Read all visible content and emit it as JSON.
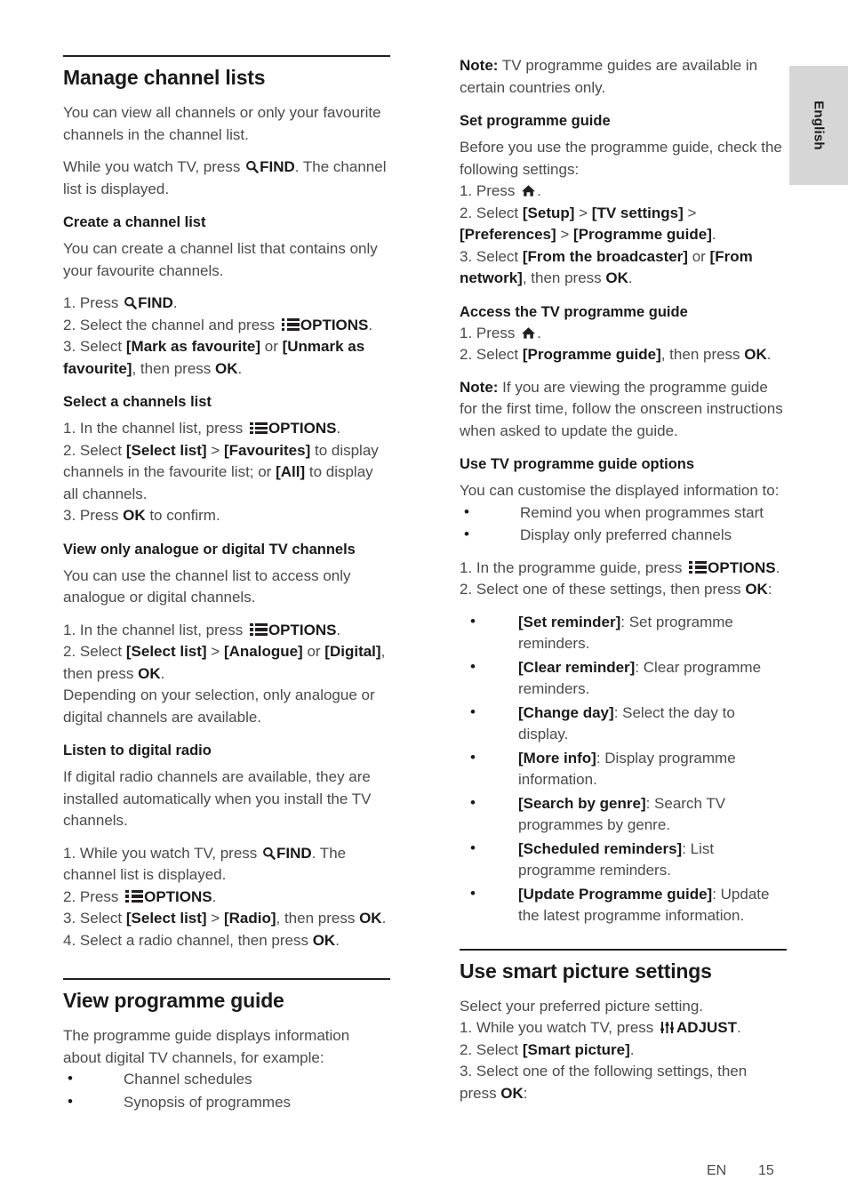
{
  "page": {
    "language_tab": "English",
    "footer_language_code": "EN",
    "footer_page_number": "15"
  },
  "icons": {
    "options": "options-list-icon",
    "home": "home-icon",
    "adjust": "adjust-sliders-icon",
    "find": "search-magnifier-icon"
  },
  "left_column": {
    "section_title": "Manage channel lists",
    "intro": "You can view all channels or only your favourite channels in the channel list.",
    "intro2_a": "While you watch TV, press ",
    "intro2_find": "FIND",
    "intro2_b": ". The channel list is displayed.",
    "create": {
      "heading": "Create a channel list",
      "body": "You can create a channel list that contains only your favourite channels.",
      "step1_a": "1. Press ",
      "step1_find": "FIND",
      "step1_b": ".",
      "step2_a": "2. Select the channel and press ",
      "step2_options": "OPTIONS",
      "step2_b": ".",
      "step3_a": "3. Select ",
      "step3_opt1": "[Mark as favourite]",
      "step3_mid": " or ",
      "step3_opt2": "[Unmark as favourite]",
      "step3_b": ", then press ",
      "step3_ok": "OK",
      "step3_c": "."
    },
    "select_list": {
      "heading": "Select a channels list",
      "step1_a": "1. In the channel list, press ",
      "step1_options": "OPTIONS",
      "step1_b": ".",
      "step2_a": "2. Select ",
      "step2_opt1": "[Select list]",
      "step2_gt": " > ",
      "step2_opt2": "[Favourites]",
      "step2_b": " to display channels in the favourite list; or ",
      "step2_opt3": "[All]",
      "step2_c": " to display all channels.",
      "step3_a": "3. Press ",
      "step3_ok": "OK",
      "step3_b": " to confirm."
    },
    "analogue_digital": {
      "heading": "View only analogue or digital TV channels",
      "body": "You can use the channel list to access only analogue or digital channels.",
      "step1_a": "1. In the channel list, press ",
      "step1_options": "OPTIONS",
      "step1_b": ".",
      "step2_a": "2. Select ",
      "step2_opt1": "[Select list]",
      "step2_gt": " > ",
      "step2_opt2": "[Analogue]",
      "step2_mid": " or ",
      "step2_opt3": "[Digital]",
      "step2_b": ", then press ",
      "step2_ok": "OK",
      "step2_c": ".",
      "note": "Depending on your selection, only analogue or digital channels are available."
    },
    "digital_radio": {
      "heading": "Listen to digital radio",
      "body": "If digital radio channels are available, they are installed automatically when you install the TV channels.",
      "step1_a": "1. While you watch TV, press ",
      "step1_find": "FIND",
      "step1_b": ". The channel list is displayed.",
      "step2_a": "2. Press ",
      "step2_options": "OPTIONS",
      "step2_b": ".",
      "step3_a": "3. Select ",
      "step3_opt1": "[Select list]",
      "step3_gt": " > ",
      "step3_opt2": "[Radio]",
      "step3_b": ", then press ",
      "step3_ok": "OK",
      "step3_c": ".",
      "step4_a": "4. Select a radio channel, then press ",
      "step4_ok": "OK",
      "step4_b": "."
    },
    "programme_guide": {
      "section_title": "View programme guide",
      "body": "The programme guide displays information about digital TV channels, for example:",
      "bullets": [
        "Channel schedules",
        "Synopsis of programmes"
      ]
    }
  },
  "right_column": {
    "note1_label": "Note:",
    "note1_text": " TV programme guides are available in certain countries only.",
    "set_guide": {
      "heading": "Set programme guide",
      "body": "Before you use the programme guide, check the following settings:",
      "step1_a": "1. Press ",
      "step1_b": ".",
      "step2_a": "2. Select ",
      "step2_opt1": "[Setup]",
      "step2_gt1": " > ",
      "step2_opt2": "[TV settings]",
      "step2_gt2": " > ",
      "step2_opt3": "[Preferences]",
      "step2_gt3": " > ",
      "step2_opt4": "[Programme guide]",
      "step2_b": ".",
      "step3_a": "3. Select ",
      "step3_opt1": "[From the broadcaster]",
      "step3_mid": " or ",
      "step3_opt2": "[From network]",
      "step3_b": ", then press ",
      "step3_ok": "OK",
      "step3_c": "."
    },
    "access_guide": {
      "heading": "Access the TV programme guide",
      "step1_a": "1. Press ",
      "step1_b": ".",
      "step2_a": "2. Select ",
      "step2_opt1": "[Programme guide]",
      "step2_b": ", then press ",
      "step2_ok": "OK",
      "step2_c": ".",
      "note_label": "Note:",
      "note_text": " If you are viewing the programme guide for the first time, follow the onscreen instructions when asked to update the guide."
    },
    "guide_options": {
      "heading": "Use TV programme guide options",
      "body": "You can customise the displayed information to:",
      "bullets": [
        "Remind you when programmes start",
        "Display only preferred channels"
      ],
      "step1_a": "1. In the programme guide, press ",
      "step1_options": "OPTIONS",
      "step1_b": ".",
      "step2_a": "2. Select one of these settings, then press ",
      "step2_ok": "OK",
      "step2_b": ":",
      "settings": [
        {
          "term": "[Set reminder]",
          "desc": ": Set programme reminders."
        },
        {
          "term": "[Clear reminder]",
          "desc": ": Clear programme reminders."
        },
        {
          "term": "[Change day]",
          "desc": ": Select the day to display."
        },
        {
          "term": "[More info]",
          "desc": ": Display programme information."
        },
        {
          "term": "[Search by genre]",
          "desc": ": Search TV programmes by genre."
        },
        {
          "term": "[Scheduled reminders]",
          "desc": ": List programme reminders."
        },
        {
          "term": "[Update Programme guide]",
          "desc": ": Update the latest programme information."
        }
      ]
    },
    "smart_picture": {
      "section_title": "Use smart picture settings",
      "body": "Select your preferred picture setting.",
      "step1_a": "1. While you watch TV, press ",
      "step1_adjust": "ADJUST",
      "step1_b": ".",
      "step2_a": "2. Select ",
      "step2_opt1": "[Smart picture]",
      "step2_b": ".",
      "step3_a": "3. Select one of the following settings, then press ",
      "step3_ok": "OK",
      "step3_b": ":"
    }
  }
}
